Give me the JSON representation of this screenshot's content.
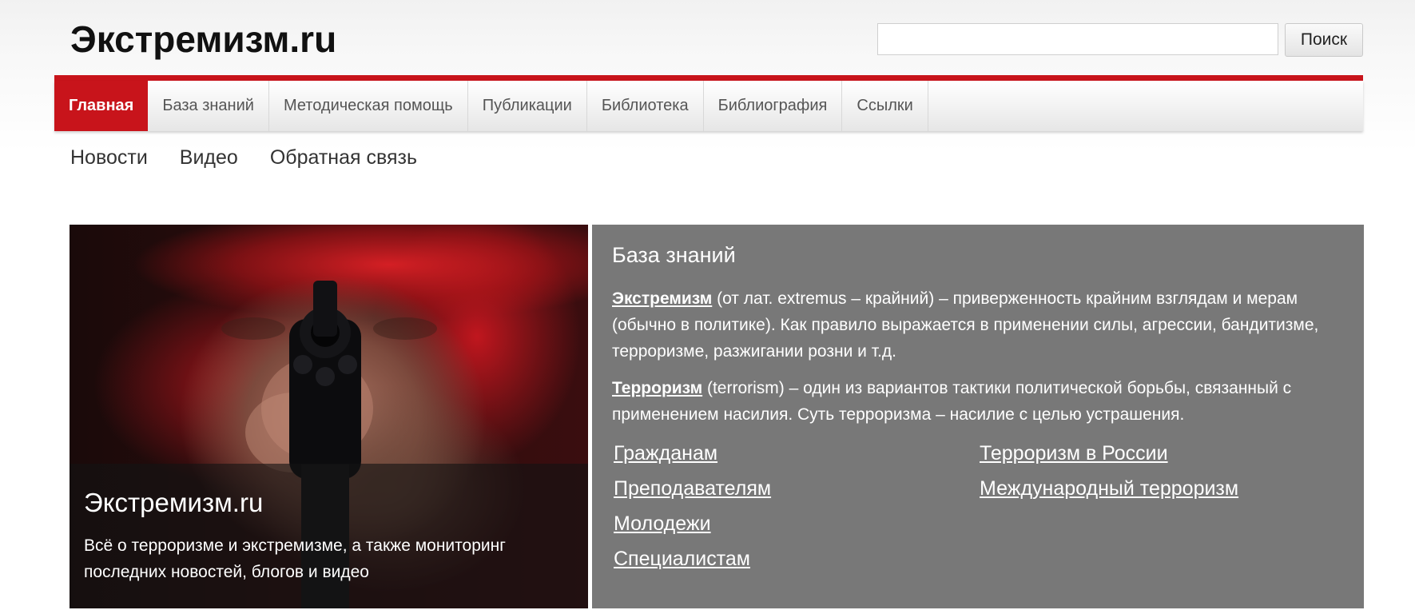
{
  "header": {
    "site_title": "Экстремизм.ru",
    "search_placeholder": "",
    "search_button": "Поиск"
  },
  "nav": [
    {
      "label": "Главная",
      "active": true
    },
    {
      "label": "База знаний"
    },
    {
      "label": "Методическая помощь"
    },
    {
      "label": "Публикации"
    },
    {
      "label": "Библиотека"
    },
    {
      "label": "Библиография"
    },
    {
      "label": "Ссылки"
    }
  ],
  "subnav": [
    "Новости",
    "Видео",
    "Обратная связь"
  ],
  "hero": {
    "title": "Экстремизм.ru",
    "description": "Всё о терроризме и экстремизме, а также мониторинг последних новостей, блогов и видео"
  },
  "knowledge_base": {
    "heading": "База знаний",
    "p1_term": "Экстремизм",
    "p1_text": " (от лат. extremus – крайний) – приверженность крайним взглядам и мерам (обычно в политике). Как правило выражается в применении силы, агрессии, бандитизме, терроризме, разжигании розни и т.д.",
    "p2_term": "Терроризм",
    "p2_text": " (terrorism) – один из вариантов тактики политической борьбы, связанный с применением насилия. Суть терроризма – насилие с целью устрашения.",
    "links_left": [
      "Гражданам",
      "Преподавателям",
      "Молодежи",
      "Специалистам"
    ],
    "links_right": [
      "Терроризм в России",
      "Международный терроризм"
    ]
  },
  "colors": {
    "brand_red": "#c8141b",
    "panel_gray": "#787878"
  }
}
